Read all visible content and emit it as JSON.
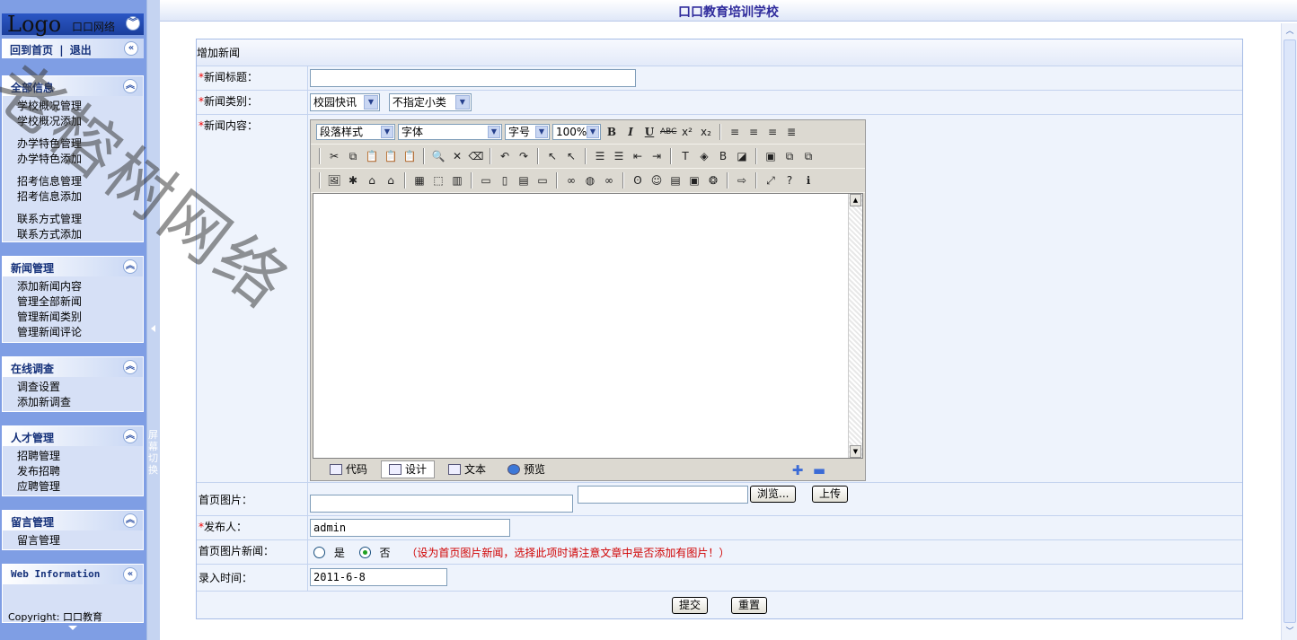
{
  "sidebar": {
    "logo": "Logo",
    "logo_sub": "口口网络",
    "home_label": "回到首页",
    "divider": "|",
    "logout_label": "退出",
    "panels": [
      {
        "title": "全部信息",
        "items": [
          "学校概况管理",
          "学校概况添加",
          "",
          "办学特色管理",
          "办学特色添加",
          "",
          "招考信息管理",
          "招考信息添加",
          "",
          "联系方式管理",
          "联系方式添加"
        ]
      },
      {
        "title": "新闻管理",
        "items": [
          "添加新闻内容",
          "管理全部新闻",
          "管理新闻类别",
          "管理新闻评论"
        ]
      },
      {
        "title": "在线调查",
        "items": [
          "调查设置",
          "添加新调查"
        ]
      },
      {
        "title": "人才管理",
        "items": [
          "招聘管理",
          "发布招聘",
          "应聘管理"
        ]
      },
      {
        "title": "留言管理",
        "items": [
          "留言管理"
        ]
      },
      {
        "title": "Web Information",
        "items": [
          "Copyright: 口口教育"
        ]
      }
    ],
    "switch_label": "屏幕切换"
  },
  "header": {
    "school_name": "口口教育培训学校"
  },
  "form": {
    "title": "增加新闻",
    "title_label": "新闻标题：",
    "title_value": "",
    "category_label": "新闻类别：",
    "category_selected": "校园快讯",
    "subcategory_selected": "不指定小类",
    "content_label": "新闻内容：",
    "editor": {
      "paragraph_style": "段落样式",
      "font": "字体",
      "font_size": "字号",
      "zoom": "100%",
      "modes": [
        "代码",
        "设计",
        "文本",
        "预览"
      ],
      "active_mode": "设计"
    },
    "image_label": "首页图片：",
    "browse_label": "浏览...",
    "upload_label": "上传",
    "publisher_label": "发布人：",
    "publisher_value": "admin",
    "image_news_label": "首页图片新闻：",
    "yes_label": "是",
    "no_label": "否",
    "image_news_warning": "（设为首页图片新闻，选择此项时请注意文章中是否添加有图片！）",
    "time_label": "录入时间：",
    "time_value": "2011-6-8",
    "submit_label": "提交",
    "reset_label": "重置"
  },
  "watermark": "老榕树网络"
}
